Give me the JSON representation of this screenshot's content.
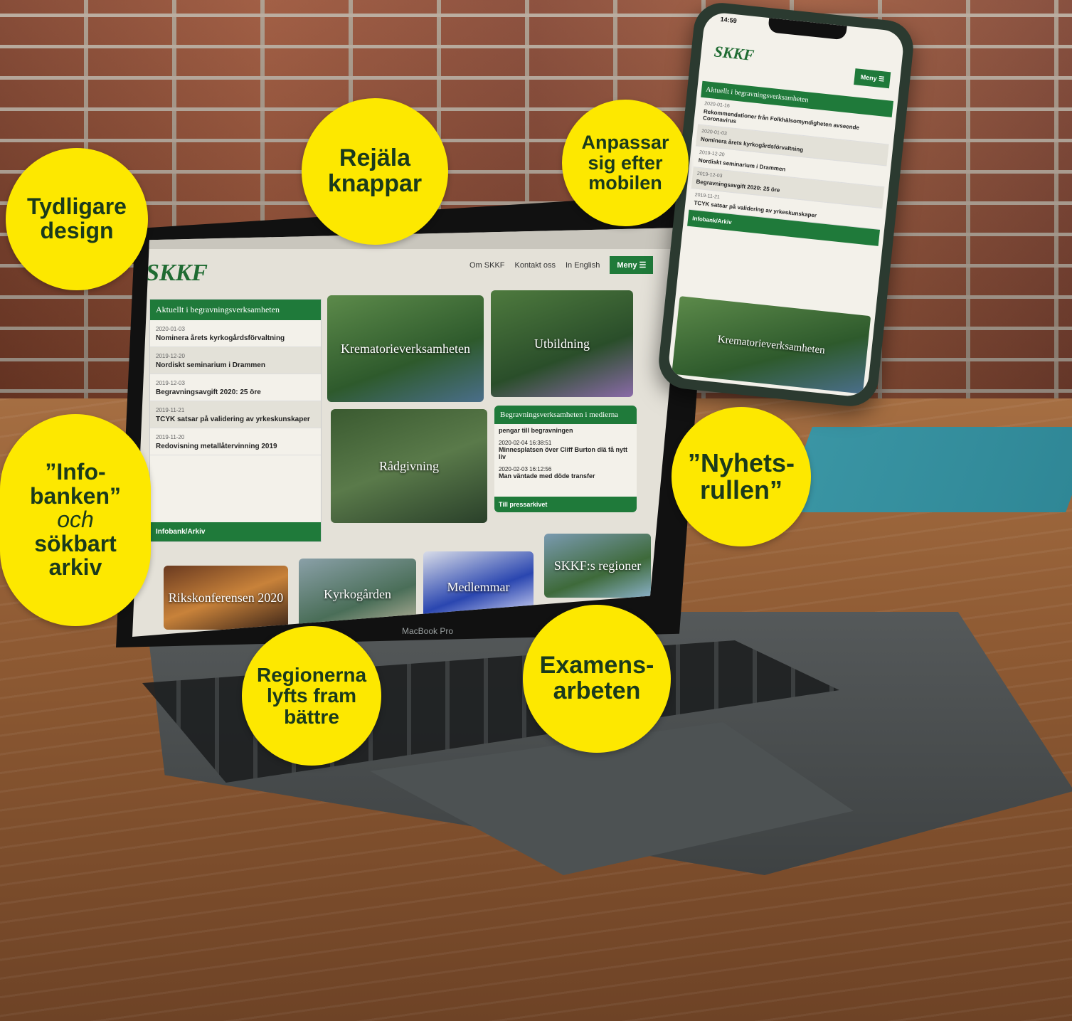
{
  "website": {
    "logo": "SKKF",
    "nav": [
      "Om SKKF",
      "Kontakt oss",
      "In English"
    ],
    "menu_label": "Meny ☰",
    "news_heading": "Aktuellt i begravningsverksamheten",
    "news": [
      {
        "date": "2020-01-03",
        "title": "Nominera årets kyrkogårdsförvaltning"
      },
      {
        "date": "2019-12-20",
        "title": "Nordiskt seminarium i Drammen"
      },
      {
        "date": "2019-12-03",
        "title": "Begravningsavgift 2020: 25 öre"
      },
      {
        "date": "2019-11-21",
        "title": "TCYK satsar på validering av yrkeskunskaper"
      },
      {
        "date": "2019-11-20",
        "title": "Redovisning metallåtervinning 2019"
      }
    ],
    "news_footer": "Infobank/Arkiv",
    "tiles": [
      "Krematorieverksamheten",
      "Utbildning",
      "Rådgivning",
      "Rikskonferensen 2020",
      "Kyrkogården",
      "Medlemmar",
      "SKKF:s regioner"
    ],
    "press": {
      "heading": "Begravningsverksamheten i medierna",
      "items": [
        {
          "title": "pengar till begravningen"
        },
        {
          "date": "2020-02-04 16:38:51",
          "title": "Minnesplatsen över Cliff Burton dlä få nytt liv"
        },
        {
          "date": "2020-02-03 16:12:56",
          "title": "Man väntade med döde transfer"
        }
      ],
      "footer": "Till pressarkivet"
    }
  },
  "laptop_label": "MacBook Pro",
  "phone": {
    "time": "14:59",
    "logo": "SKKF",
    "menu_label": "Meny ☰",
    "news_heading": "Aktuellt i begravningsverksamheten",
    "news": [
      {
        "date": "2020-01-16",
        "title": "Rekommendationer från Folkhälsomyndigheten avseende Coronavirus"
      },
      {
        "date": "2020-01-03",
        "title": "Nominera årets kyrkogårdsförvaltning"
      },
      {
        "date": "2019-12-20",
        "title": "Nordiskt seminarium i Drammen"
      },
      {
        "date": "2019-12-03",
        "title": "Begravningsavgift 2020: 25 öre"
      },
      {
        "date": "2019-11-21",
        "title": "TCYK satsar på validering av yrkeskunskaper"
      }
    ],
    "footer": "Infobank/Arkiv",
    "tile": "Krematorieverksamheten"
  },
  "callouts": {
    "tydligare": [
      "Tydligare",
      "design"
    ],
    "rejala": [
      "Rejäla",
      "knappar"
    ],
    "anpassar": [
      "Anpassar",
      "sig efter",
      "mobilen"
    ],
    "info": [
      "”Info-",
      "banken”",
      "och",
      "sökbart",
      "arkiv"
    ],
    "nyhets": [
      "”Nyhets-",
      "rullen”"
    ],
    "regionerna": [
      "Regionerna",
      "lyfts fram",
      "bättre"
    ],
    "examens": [
      "Examens-",
      "arbeten"
    ]
  },
  "colors": {
    "accent_green": "#1f7a3a",
    "callout_yellow": "#fde800"
  }
}
